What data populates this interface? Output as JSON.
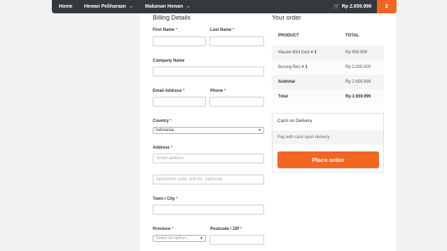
{
  "nav": {
    "items": [
      {
        "label": "Home",
        "has_dropdown": false
      },
      {
        "label": "Hewan Peliharaan",
        "has_dropdown": true
      },
      {
        "label": "Makanan Hewan",
        "has_dropdown": true
      }
    ],
    "cart_total": "Rp 2.659.999",
    "cart_count": "2",
    "cart_icon": "shopping-cart-icon",
    "accent_color": "#f26522",
    "bar_color": "#33393f"
  },
  "billing": {
    "title": "Billing Details",
    "required_mark": "*",
    "first_name_label": "First Name",
    "last_name_label": "Last Name",
    "company_label": "Company Name",
    "email_label": "Email Address",
    "phone_label": "Phone",
    "country_label": "Country",
    "country_value": "Indonesia",
    "address_label": "Address",
    "address_placeholder": "Street address",
    "address2_placeholder": "Apartment, suite, unit etc. (optional)",
    "city_label": "Town / City",
    "province_label": "Province",
    "province_placeholder": "Select an option...",
    "postcode_label": "Postcode / ZIP"
  },
  "order": {
    "title": "Your order",
    "col_product": "PRODUCT",
    "col_total": "TOTAL",
    "items": [
      {
        "name": "Macaw Bird food",
        "qty": "× 1",
        "total": "Rp 659.999"
      },
      {
        "name": "Burung Beo",
        "qty": "× 1",
        "total": "Rp 2.000.000"
      }
    ],
    "subtotal_label": "Subtotal",
    "subtotal_value": "Rp 2.659.999",
    "total_label": "Total",
    "total_value": "Rp 2.659.999"
  },
  "payment": {
    "method": "Cash on Delivery",
    "description": "Pay with cash upon delivery.",
    "button_label": "Place order"
  }
}
